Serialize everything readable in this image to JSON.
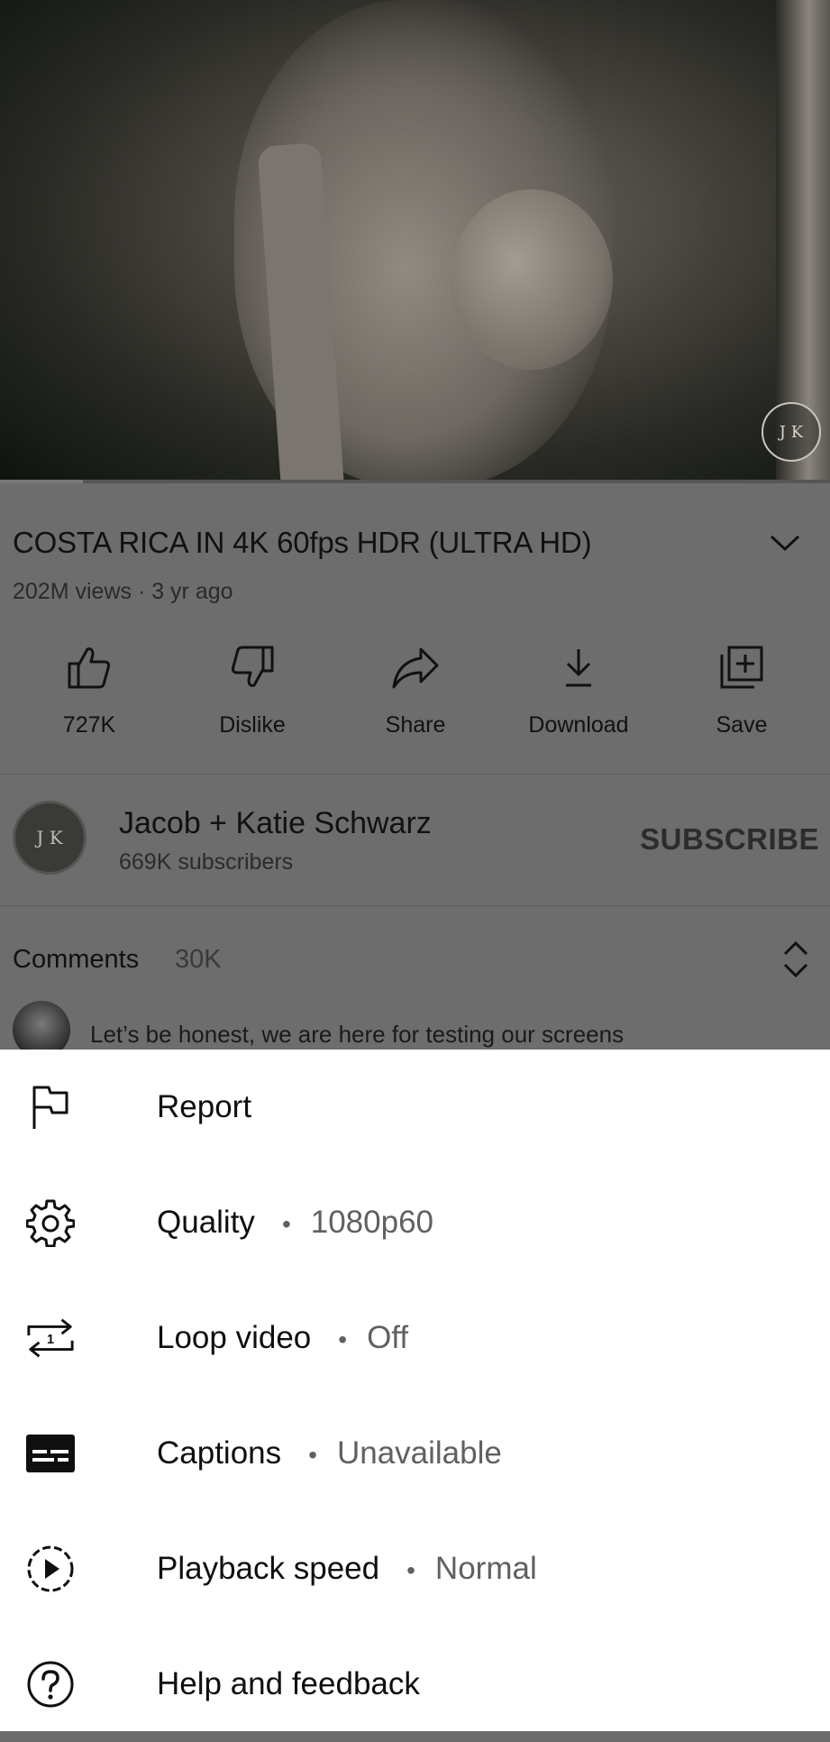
{
  "video": {
    "watermark": "J K",
    "progress": 0.1
  },
  "details": {
    "title": "COSTA RICA IN 4K 60fps HDR (ULTRA HD)",
    "meta": "202M views · 3 yr ago"
  },
  "actions": [
    {
      "label": "727K",
      "icon": "thumbs-up-icon"
    },
    {
      "label": "Dislike",
      "icon": "thumbs-down-icon"
    },
    {
      "label": "Share",
      "icon": "share-icon"
    },
    {
      "label": "Download",
      "icon": "download-icon"
    },
    {
      "label": "Save",
      "icon": "add-to-playlist-icon"
    }
  ],
  "channel": {
    "name": "Jacob + Katie Schwarz",
    "subscribers": "669K subscribers",
    "subscribe_label": "SUBSCRIBE",
    "avatar_text": "J K"
  },
  "comments": {
    "label": "Comments",
    "count": "30K",
    "top_comment": "Let’s be honest, we are here for testing our screens"
  },
  "menu": [
    {
      "label": "Report",
      "value": "",
      "icon": "flag-icon"
    },
    {
      "label": "Quality",
      "value": "1080p60",
      "icon": "gear-icon"
    },
    {
      "label": "Loop video",
      "value": "Off",
      "icon": "loop-icon"
    },
    {
      "label": "Captions",
      "value": "Unavailable",
      "icon": "captions-icon"
    },
    {
      "label": "Playback speed",
      "value": "Normal",
      "icon": "playback-speed-icon"
    },
    {
      "label": "Help and feedback",
      "value": "",
      "icon": "help-icon"
    }
  ],
  "colors": {
    "sheet_background": "#ffffff",
    "scrim": "#6d6d6d",
    "secondary_text": "#606060"
  }
}
